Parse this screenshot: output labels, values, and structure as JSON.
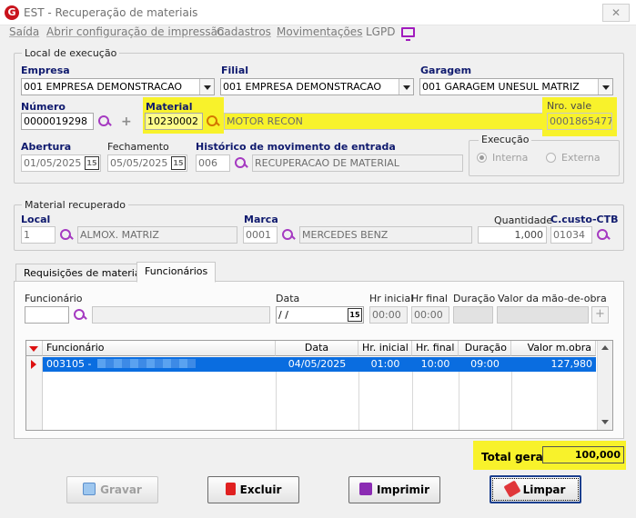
{
  "window": {
    "title": "EST - Recuperação de materiais",
    "close_glyph": "✕",
    "app_icon_letter": "G"
  },
  "menu": [
    "Saída",
    "Abrir configuração de impressão",
    "Cadastros",
    "Movimentações",
    "LGPD"
  ],
  "local_execucao": {
    "group_title": "Local de execução",
    "empresa": {
      "label": "Empresa",
      "value": "001 EMPRESA DEMONSTRACAO"
    },
    "filial": {
      "label": "Filial",
      "value": "001 EMPRESA DEMONSTRACAO"
    },
    "garagem": {
      "label": "Garagem",
      "value": "001 GARAGEM UNESUL MATRIZ"
    },
    "numero": {
      "label": "Número",
      "value": "0000019298"
    },
    "material": {
      "label": "Material",
      "code": "10230002",
      "description": "MOTOR RECON"
    },
    "nro_vale": {
      "label": "Nro. vale",
      "value": "0001865477"
    },
    "abertura": {
      "label": "Abertura",
      "value": "01/05/2025"
    },
    "fechamento": {
      "label": "Fechamento",
      "value": "05/05/2025"
    },
    "historico": {
      "label": "Histórico de movimento de entrada",
      "code": "006",
      "description": "RECUPERACAO DE MATERIAL"
    },
    "execucao": {
      "title": "Execução",
      "options": [
        "Interna",
        "Externa"
      ],
      "selected": "Interna"
    }
  },
  "material_recuperado": {
    "group_title": "Material recuperado",
    "local": {
      "label": "Local",
      "code": "1",
      "description": "ALMOX. MATRIZ"
    },
    "marca": {
      "label": "Marca",
      "code": "0001",
      "description": "MERCEDES BENZ"
    },
    "quantidade": {
      "label": "Quantidade",
      "value": "1,000"
    },
    "ccusto": {
      "label": "C.custo-CTB",
      "value": "01034"
    }
  },
  "tabs": [
    "Requisições de material",
    "Funcionários"
  ],
  "active_tab": "Funcionários",
  "funcionarios_form": {
    "funcionario_label": "Funcionário",
    "data_label": "Data",
    "data_value": " /  /",
    "hr_inicial_label": "Hr inicial",
    "hr_inicial_value": "00:00",
    "hr_final_label": "Hr final",
    "hr_final_value": "00:00",
    "duracao_label": "Duração",
    "valor_label": "Valor da mão-de-obra"
  },
  "grid": {
    "columns": [
      "Funcionário",
      "Data",
      "Hr. inicial",
      "Hr. final",
      "Duração",
      "Valor m.obra"
    ],
    "rows": [
      {
        "funcionario": "003105 -",
        "data": "04/05/2025",
        "hr_inicial": "01:00",
        "hr_final": "10:00",
        "duracao": "09:00",
        "valor": "127,980"
      }
    ]
  },
  "total": {
    "label": "Total geral",
    "value": "100,000"
  },
  "buttons": {
    "gravar": "Gravar",
    "excluir": "Excluir",
    "imprimir": "Imprimir",
    "limpar": "Limpar"
  },
  "calendar_glyph": "15",
  "colors": {
    "highlight": "#f8f22b",
    "selection": "#0a6de0",
    "label_blue": "#0f1a6e",
    "icon_purple": "#a53ac1"
  }
}
